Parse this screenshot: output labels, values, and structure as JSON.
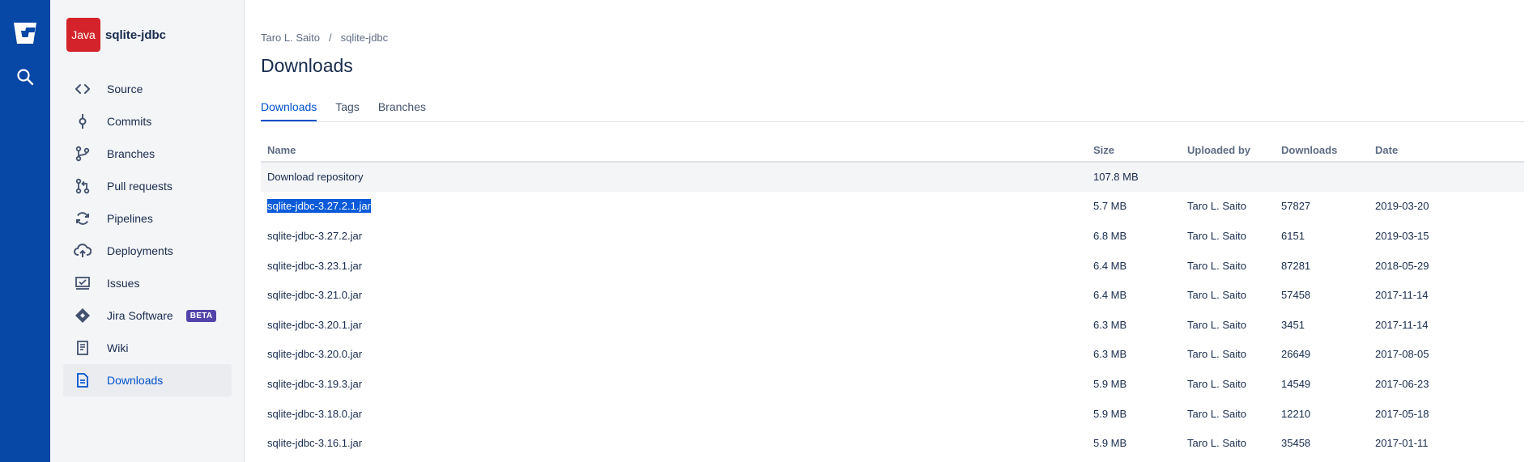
{
  "project": {
    "avatar_text": "Java",
    "name": "sqlite-jdbc"
  },
  "sidebar": {
    "items": [
      {
        "label": "Source",
        "icon": "code-icon"
      },
      {
        "label": "Commits",
        "icon": "commit-icon"
      },
      {
        "label": "Branches",
        "icon": "branch-icon"
      },
      {
        "label": "Pull requests",
        "icon": "pull-request-icon"
      },
      {
        "label": "Pipelines",
        "icon": "pipelines-icon"
      },
      {
        "label": "Deployments",
        "icon": "cloud-upload-icon"
      },
      {
        "label": "Issues",
        "icon": "issues-icon"
      },
      {
        "label": "Jira Software",
        "icon": "jira-icon",
        "badge": "BETA"
      },
      {
        "label": "Wiki",
        "icon": "wiki-icon"
      },
      {
        "label": "Downloads",
        "icon": "downloads-icon",
        "active": true
      }
    ]
  },
  "breadcrumb": {
    "owner": "Taro L. Saito",
    "separator": "/",
    "repo": "sqlite-jdbc"
  },
  "page_title": "Downloads",
  "tabs": [
    {
      "label": "Downloads",
      "active": true
    },
    {
      "label": "Tags"
    },
    {
      "label": "Branches"
    }
  ],
  "table": {
    "headers": {
      "name": "Name",
      "size": "Size",
      "uploaded_by": "Uploaded by",
      "downloads": "Downloads",
      "date": "Date"
    },
    "repo_row": {
      "name": "Download repository",
      "size": "107.8 MB"
    },
    "rows": [
      {
        "name": "sqlite-jdbc-3.27.2.1.jar",
        "size": "5.7 MB",
        "uploaded_by": "Taro L. Saito",
        "downloads": "57827",
        "date": "2019-03-20"
      },
      {
        "name": "sqlite-jdbc-3.27.2.jar",
        "size": "6.8 MB",
        "uploaded_by": "Taro L. Saito",
        "downloads": "6151",
        "date": "2019-03-15"
      },
      {
        "name": "sqlite-jdbc-3.23.1.jar",
        "size": "6.4 MB",
        "uploaded_by": "Taro L. Saito",
        "downloads": "87281",
        "date": "2018-05-29"
      },
      {
        "name": "sqlite-jdbc-3.21.0.jar",
        "size": "6.4 MB",
        "uploaded_by": "Taro L. Saito",
        "downloads": "57458",
        "date": "2017-11-14"
      },
      {
        "name": "sqlite-jdbc-3.20.1.jar",
        "size": "6.3 MB",
        "uploaded_by": "Taro L. Saito",
        "downloads": "3451",
        "date": "2017-11-14"
      },
      {
        "name": "sqlite-jdbc-3.20.0.jar",
        "size": "6.3 MB",
        "uploaded_by": "Taro L. Saito",
        "downloads": "26649",
        "date": "2017-08-05"
      },
      {
        "name": "sqlite-jdbc-3.19.3.jar",
        "size": "5.9 MB",
        "uploaded_by": "Taro L. Saito",
        "downloads": "14549",
        "date": "2017-06-23"
      },
      {
        "name": "sqlite-jdbc-3.18.0.jar",
        "size": "5.9 MB",
        "uploaded_by": "Taro L. Saito",
        "downloads": "12210",
        "date": "2017-05-18"
      },
      {
        "name": "sqlite-jdbc-3.16.1.jar",
        "size": "5.9 MB",
        "uploaded_by": "Taro L. Saito",
        "downloads": "35458",
        "date": "2017-01-11"
      }
    ]
  },
  "colors": {
    "rail": "#0747a6",
    "accent": "#0052cc",
    "avatar": "#d4232a",
    "beta": "#5243aa",
    "selection": "#0a5ad9"
  }
}
